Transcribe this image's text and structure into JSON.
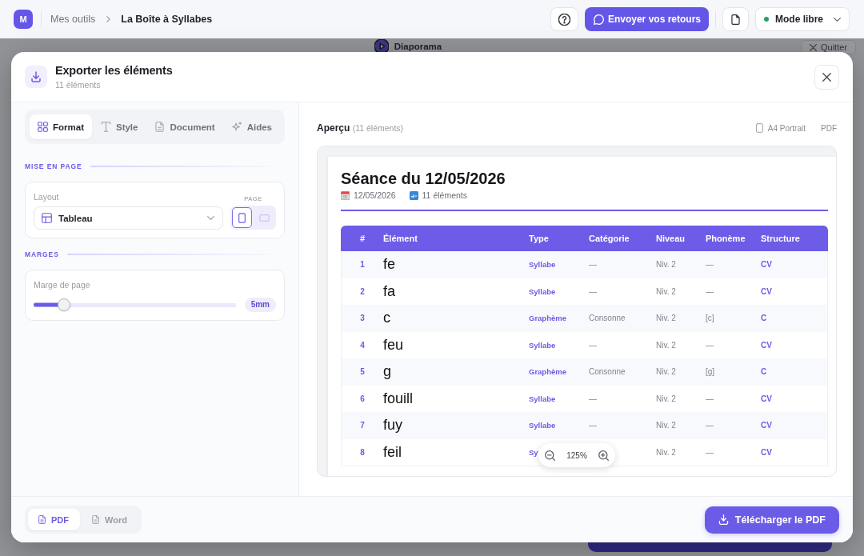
{
  "top_bar": {
    "logo": "M",
    "breadcrumb": [
      {
        "label": "Mes outils",
        "current": false
      },
      {
        "label": "La Boîte à Syllabes",
        "current": true
      }
    ],
    "feedback_button": "Envoyer vos retours",
    "mode_menu": "Mode libre"
  },
  "background": {
    "title": "Diaporama",
    "exit_button": "Quitter"
  },
  "dialog": {
    "title": "Exporter les éléments",
    "subtitle": "11 éléments",
    "tabs": [
      {
        "label": "Format",
        "selected": true
      },
      {
        "label": "Style",
        "selected": false
      },
      {
        "label": "Document",
        "selected": false
      },
      {
        "label": "Aides",
        "selected": false
      }
    ],
    "layout_section": {
      "heading": "MISE EN PAGE",
      "field_label": "Layout",
      "value": "Tableau",
      "page_label": "PAGE",
      "orientations": [
        {
          "kind": "portrait",
          "selected": true
        },
        {
          "kind": "landscape",
          "selected": false
        }
      ]
    },
    "margins_section": {
      "heading": "MARGES",
      "field_label": "Marge de page",
      "level": 0.15,
      "value": "5mm"
    },
    "preview": {
      "title": "Aperçu",
      "count": "(11 éléments)",
      "page_format": "A4 Portrait",
      "file_type": "PDF",
      "zoom": "125%",
      "document": {
        "title": "Séance du 12/05/2026",
        "date": "12/05/2026",
        "item_count": "11 éléments",
        "columns": [
          "#",
          "Élément",
          "Type",
          "Catégorie",
          "Niveau",
          "Phonème",
          "Structure"
        ],
        "rows": [
          {
            "num": "1",
            "element": "fe",
            "type": "Syllabe",
            "category": "—",
            "niveau": "Niv. 2",
            "phoneme": "—",
            "structure": "CV"
          },
          {
            "num": "2",
            "element": "fa",
            "type": "Syllabe",
            "category": "—",
            "niveau": "Niv. 2",
            "phoneme": "—",
            "structure": "CV"
          },
          {
            "num": "3",
            "element": "c",
            "type": "Graphème",
            "category": "Consonne",
            "niveau": "Niv. 2",
            "phoneme": "[c]",
            "structure": "C"
          },
          {
            "num": "4",
            "element": "feu",
            "type": "Syllabe",
            "category": "—",
            "niveau": "Niv. 2",
            "phoneme": "—",
            "structure": "CV"
          },
          {
            "num": "5",
            "element": "g",
            "type": "Graphème",
            "category": "Consonne",
            "niveau": "Niv. 2",
            "phoneme": "[g]",
            "structure": "C"
          },
          {
            "num": "6",
            "element": "fouill",
            "type": "Syllabe",
            "category": "—",
            "niveau": "Niv. 2",
            "phoneme": "—",
            "structure": "CV"
          },
          {
            "num": "7",
            "element": "fuy",
            "type": "Syllabe",
            "category": "—",
            "niveau": "Niv. 2",
            "phoneme": "—",
            "structure": "CV"
          },
          {
            "num": "8",
            "element": "feil",
            "type": "Sy",
            "niveau": "Niv. 2",
            "phoneme": "—",
            "structure": "CV"
          }
        ]
      }
    },
    "footer": {
      "formats": [
        {
          "label": "PDF",
          "selected": true
        },
        {
          "label": "Word",
          "selected": false
        }
      ],
      "download_button": "Télécharger le PDF"
    }
  }
}
